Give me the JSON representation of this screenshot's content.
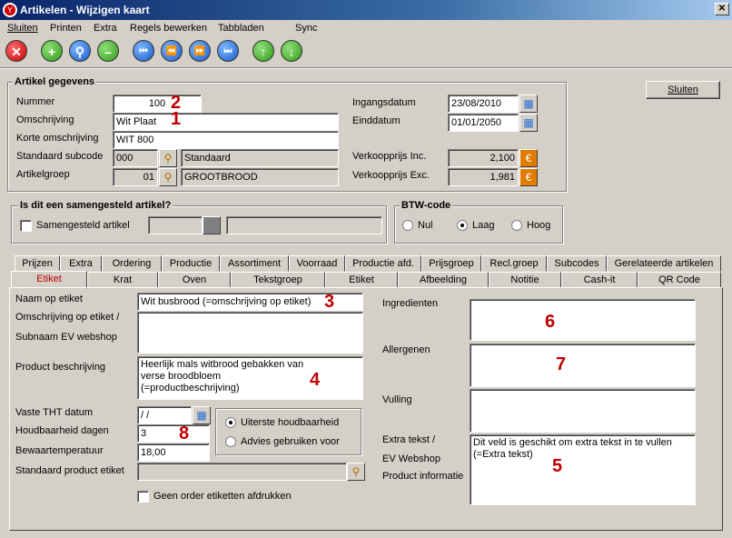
{
  "window": {
    "title": "Artikelen - Wijzigen kaart",
    "logo_glyph": "Y",
    "close_glyph": "✕"
  },
  "menu": [
    "Sluiten",
    "Printen",
    "Extra",
    "Regels bewerken",
    "Tabbladen",
    "Sync"
  ],
  "toolbar": {
    "close_glyph": "✕",
    "add_glyph": "+",
    "search_glyph": "⚲",
    "remove_glyph": "–",
    "first_glyph": "⏮",
    "prev_glyph": "⏪",
    "next_glyph": "⏩",
    "last_glyph": "⏭",
    "up_glyph": "↑",
    "down_glyph": "↓"
  },
  "close_button": "Sluiten",
  "artikel": {
    "group_title": "Artikel gegevens",
    "nummer_label": "Nummer",
    "nummer": "100",
    "omschrijving_label": "Omschrijving",
    "omschrijving": "Wit Plaat",
    "korte_label": "Korte omschrijving",
    "korte": "WIT 800",
    "subcode_label": "Standaard subcode",
    "subcode": "000",
    "subcode_name": "Standaard",
    "groep_label": "Artikelgroep",
    "groep": "01",
    "groep_name": "GROOTBROOD",
    "ingang_label": "Ingangsdatum",
    "ingang": "23/08/2010",
    "eind_label": "Einddatum",
    "eind": "01/01/2050",
    "inc_label": "Verkoopprijs Inc.",
    "inc": "2,100",
    "exc_label": "Verkoopprijs Exc.",
    "exc": "1,981",
    "cal_glyph": "▦",
    "euro_glyph": "€",
    "search_glyph": "⚲"
  },
  "samengesteld": {
    "group_title": "Is dit een samengesteld artikel?",
    "checkbox_label": "Samengesteld artikel"
  },
  "btw": {
    "group_title": "BTW-code",
    "options": [
      "Nul",
      "Laag",
      "Hoog"
    ],
    "selected": "Laag"
  },
  "tabs_row1": [
    "Prijzen",
    "Extra",
    "Ordering",
    "Productie",
    "Assortiment",
    "Voorraad",
    "Productie afd.",
    "Prijsgroep",
    "Recl.groep",
    "Subcodes",
    "Gerelateerde artikelen"
  ],
  "tabs_row2": [
    "Etiket",
    "Krat",
    "Oven",
    "Tekstgroep",
    "Etiket",
    "Afbeelding",
    "Notitie",
    "Cash-it",
    "QR Code"
  ],
  "etiket": {
    "naam_label": "Naam op etiket",
    "naam": "Wit busbrood (=omschrijving op etiket)",
    "omschr_label1": "Omschrijving op etiket /",
    "omschr_label2": "Subnaam EV webshop",
    "product_label": "Product beschrijving",
    "product": "Heerlijk mals witbrood gebakken van verse broodbloem (=productbeschrijving)",
    "tht_label": "Vaste THT datum",
    "tht": "/ /",
    "houdbaar_label": "Houdbaarheid dagen",
    "houdbaar": "3",
    "temp_label": "Bewaartemperatuur",
    "temp": "18,00",
    "std_label": "Standaard product etiket",
    "radio_options": [
      "Uiterste houdbaarheid",
      "Advies gebruiken voor"
    ],
    "radio_selected": "Uiterste houdbaarheid",
    "geen_order_label": "Geen order etiketten afdrukken",
    "ingredienten_label": "Ingredienten",
    "allergenen_label": "Allergenen",
    "vulling_label": "Vulling",
    "extra_label1": "Extra tekst /",
    "extra_label2": "EV Webshop",
    "extra_label3": "Product informatie",
    "extra": "Dit veld is geschikt om extra tekst in te vullen (=Extra tekst)"
  },
  "annotations": [
    "1",
    "2",
    "3",
    "4",
    "5",
    "6",
    "7",
    "8"
  ]
}
